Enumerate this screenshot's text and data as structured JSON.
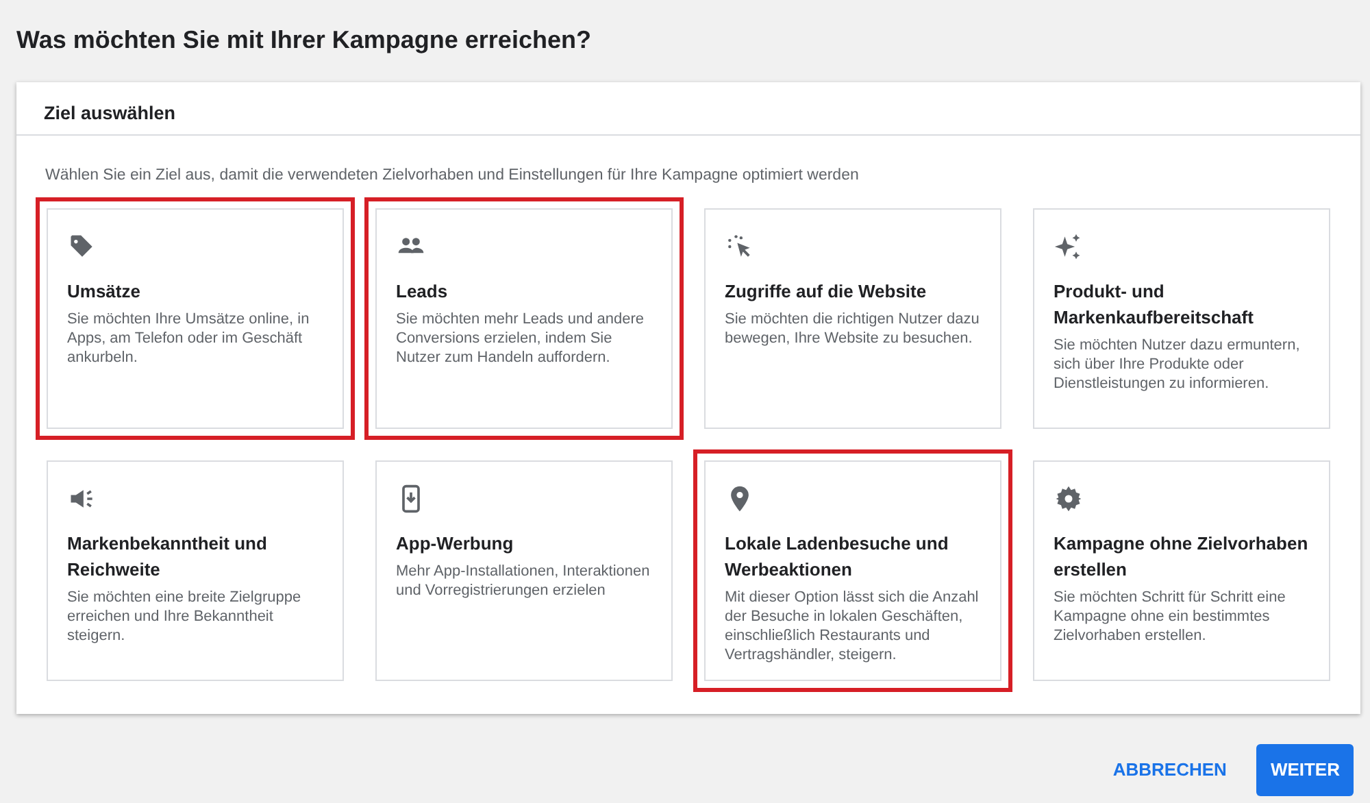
{
  "page_title": "Was möchten Sie mit Ihrer Kampagne erreichen?",
  "panel": {
    "title": "Ziel auswählen",
    "instruction": "Wählen Sie ein Ziel aus, damit die verwendeten Zielvorhaben und Einstellungen für Ihre Kampagne optimiert werden",
    "goals": [
      {
        "title": "Umsätze",
        "description": "Sie möchten Ihre Umsätze online, in Apps, am Telefon oder im Geschäft ankurbeln.",
        "highlighted": true
      },
      {
        "title": "Leads",
        "description": "Sie möchten mehr Leads und andere Conversions erzielen, indem Sie Nutzer zum Handeln auffordern.",
        "highlighted": true
      },
      {
        "title": "Zugriffe auf die Website",
        "description": "Sie möchten die richtigen Nutzer dazu bewegen, Ihre Website zu besuchen.",
        "highlighted": false
      },
      {
        "title": "Produkt- und Markenkaufbereitschaft",
        "description": "Sie möchten Nutzer dazu ermuntern, sich über Ihre Produkte oder Dienstleistungen zu informieren.",
        "highlighted": false
      },
      {
        "title": "Markenbekanntheit und Reichweite",
        "description": "Sie möchten eine breite Zielgruppe erreichen und Ihre Bekanntheit steigern.",
        "highlighted": false
      },
      {
        "title": "App-Werbung",
        "description": "Mehr App-Installationen, Interaktionen und Vorregistrierungen erzielen",
        "highlighted": false
      },
      {
        "title": "Lokale Ladenbesuche und Werbeaktionen",
        "description": "Mit dieser Option lässt sich die Anzahl der Besuche in lokalen Geschäften, einschließlich Restaurants und Vertragshändler, steigern.",
        "highlighted": true
      },
      {
        "title": "Kampagne ohne Zielvorhaben erstellen",
        "description": "Sie möchten Schritt für Schritt eine Kampagne ohne ein bestimmtes Zielvorhaben erstellen.",
        "highlighted": false
      }
    ]
  },
  "buttons": [
    {
      "label": "ABBRECHEN",
      "kind": "text"
    },
    {
      "label": "WEITER",
      "kind": "primary"
    }
  ]
}
